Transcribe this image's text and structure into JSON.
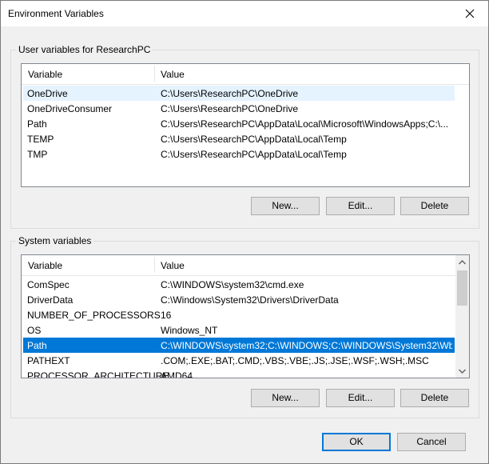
{
  "window": {
    "title": "Environment Variables"
  },
  "user_vars": {
    "group_label": "User variables for ResearchPC",
    "columns": [
      "Variable",
      "Value"
    ],
    "rows": [
      {
        "name": "OneDrive",
        "value": "C:\\Users\\ResearchPC\\OneDrive"
      },
      {
        "name": "OneDriveConsumer",
        "value": "C:\\Users\\ResearchPC\\OneDrive"
      },
      {
        "name": "Path",
        "value": "C:\\Users\\ResearchPC\\AppData\\Local\\Microsoft\\WindowsApps;C:\\..."
      },
      {
        "name": "TEMP",
        "value": "C:\\Users\\ResearchPC\\AppData\\Local\\Temp"
      },
      {
        "name": "TMP",
        "value": "C:\\Users\\ResearchPC\\AppData\\Local\\Temp"
      }
    ],
    "buttons": {
      "new": "New...",
      "edit": "Edit...",
      "delete": "Delete"
    }
  },
  "system_vars": {
    "group_label": "System variables",
    "columns": [
      "Variable",
      "Value"
    ],
    "rows": [
      {
        "name": "ComSpec",
        "value": "C:\\WINDOWS\\system32\\cmd.exe"
      },
      {
        "name": "DriverData",
        "value": "C:\\Windows\\System32\\Drivers\\DriverData"
      },
      {
        "name": "NUMBER_OF_PROCESSORS",
        "value": "16"
      },
      {
        "name": "OS",
        "value": "Windows_NT"
      },
      {
        "name": "Path",
        "value": "C:\\WINDOWS\\system32;C:\\WINDOWS;C:\\WINDOWS\\System32\\Wb..."
      },
      {
        "name": "PATHEXT",
        "value": ".COM;.EXE;.BAT;.CMD;.VBS;.VBE;.JS;.JSE;.WSF;.WSH;.MSC"
      },
      {
        "name": "PROCESSOR_ARCHITECTURE",
        "value": "AMD64"
      }
    ],
    "buttons": {
      "new": "New...",
      "edit": "Edit...",
      "delete": "Delete"
    }
  },
  "footer": {
    "ok": "OK",
    "cancel": "Cancel"
  },
  "colors": {
    "selection": "#0078d7",
    "hover": "#e5f3ff"
  },
  "icons": {
    "close": "close-icon",
    "scroll_up": "chevron-up-icon",
    "scroll_down": "chevron-down-icon"
  }
}
